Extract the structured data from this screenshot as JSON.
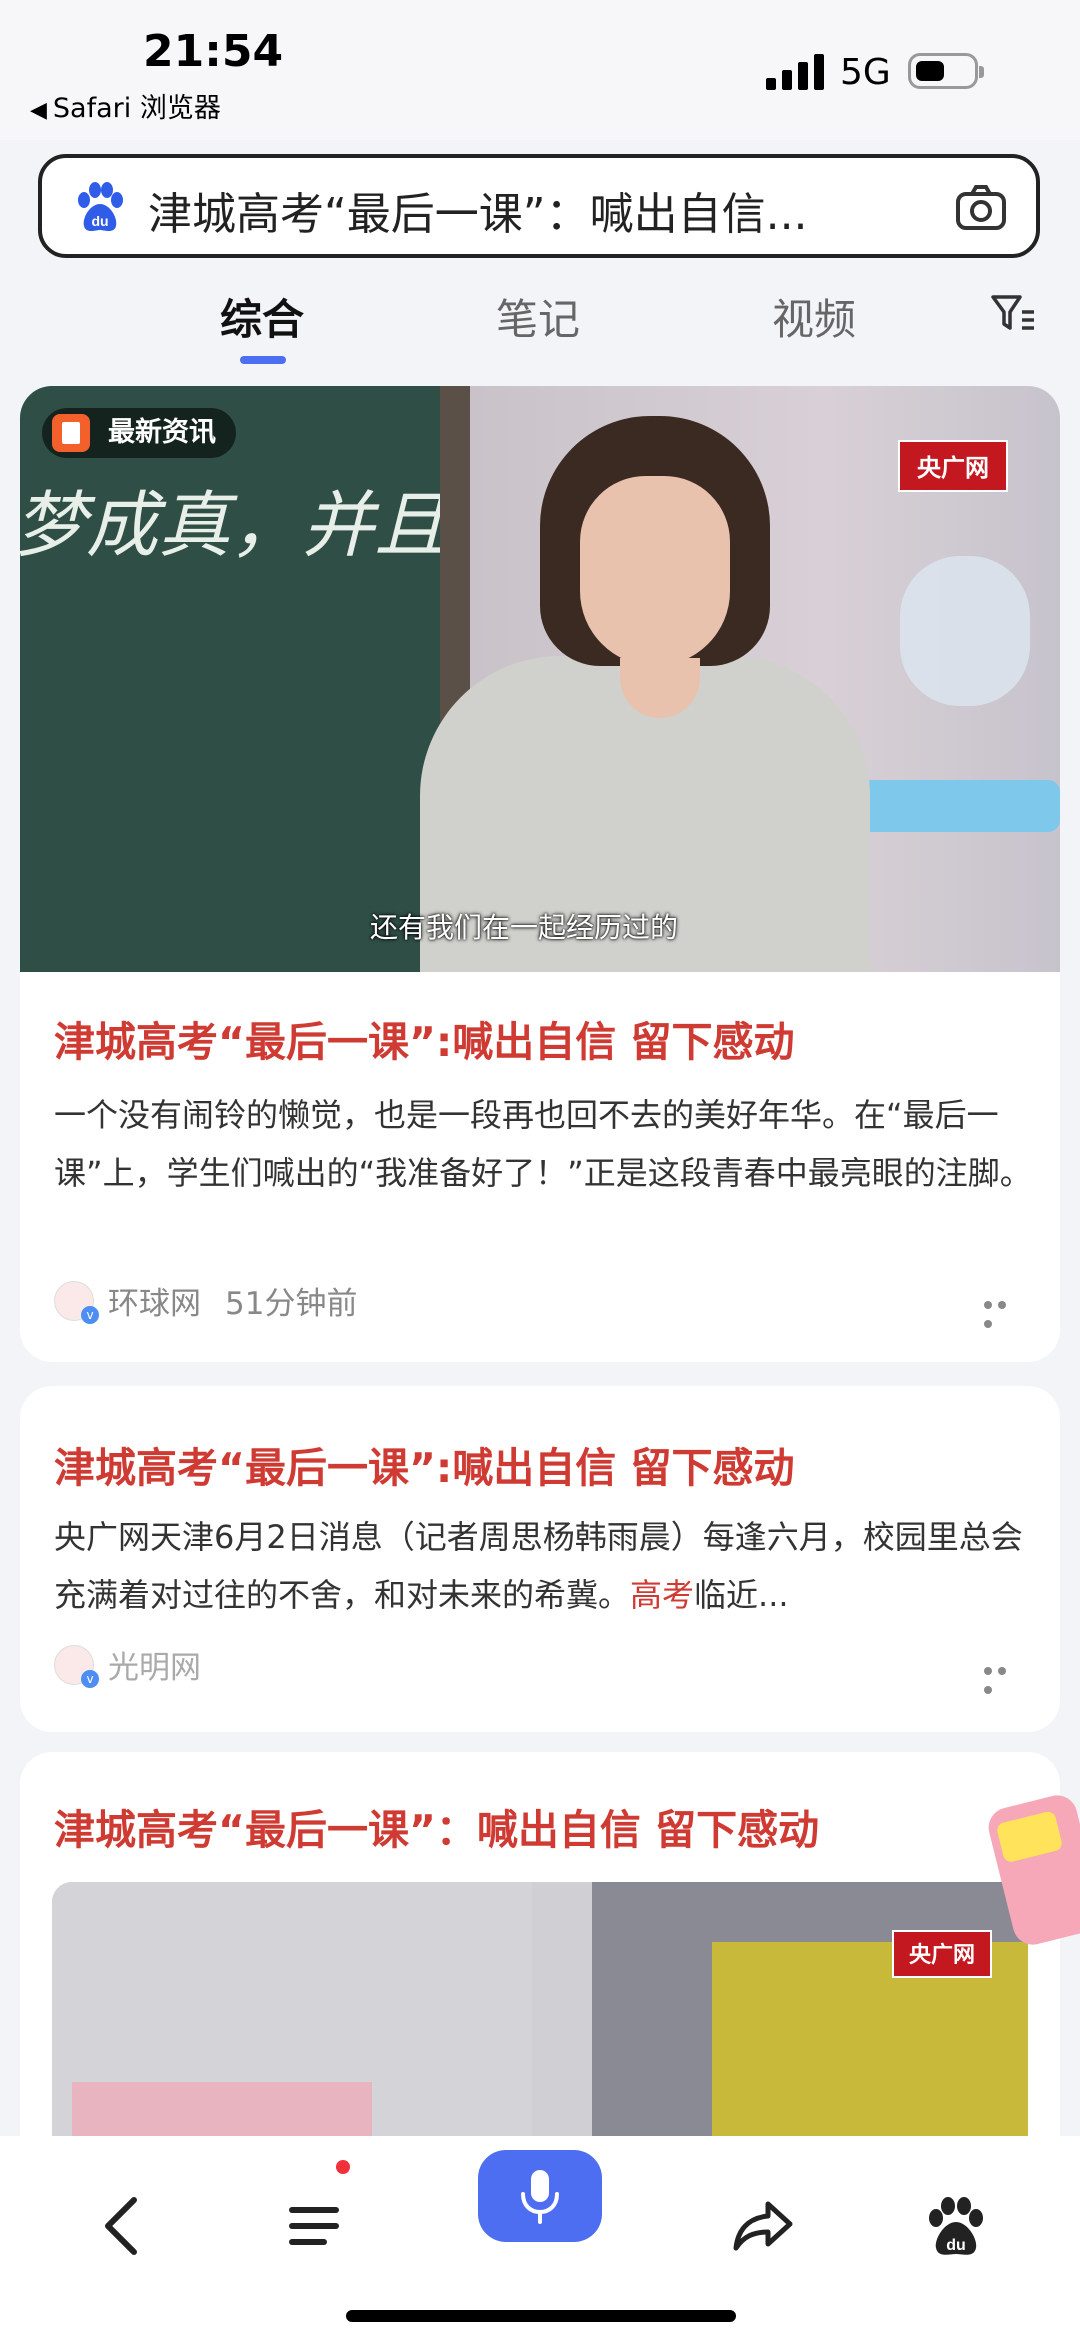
{
  "status_bar": {
    "time": "21:54",
    "back_app": "Safari 浏览器",
    "network": "5G"
  },
  "search": {
    "query": "津城高考“最后一课”：喊出自信..."
  },
  "tabs": [
    {
      "label": "综合",
      "active": true
    },
    {
      "label": "笔记",
      "active": false
    },
    {
      "label": "视频",
      "active": false
    }
  ],
  "cards": [
    {
      "badge": "最新资讯",
      "image_logo": "央广网",
      "image_subtitle": "还有我们在一起经历过的",
      "image_chalk_text": "梦成真，并且",
      "title": "津城高考“最后一课”:喊出自信 留下感动",
      "summary": "一个没有闹铃的懒觉，也是一段再也回不去的美好年华。在“最后一课”上，学生们喊出的“我准备好了！”正是这段青春中最亮眼的注脚。",
      "source": "环球网",
      "time": "51分钟前"
    },
    {
      "title": "津城高考“最后一课”:喊出自信 留下感动",
      "summary_before": "央广网天津6月2日消息（记者周思杨韩雨晨）每逢六月，校园里总会充满着对过往的不舍，和对未来的希冀。",
      "summary_highlight": "高考",
      "summary_after": "临近...",
      "source": "光明网"
    },
    {
      "title": "津城高考“最后一课”：喊出自信 留下感动",
      "image_logo": "央广网"
    }
  ],
  "colors": {
    "accent": "#4e6ef2",
    "headline": "#cf3b33",
    "badge_orange": "#f3602b"
  },
  "icons": [
    "baidu-paw-icon",
    "camera-icon",
    "filter-icon",
    "more-icon",
    "back-icon",
    "menu-icon",
    "mic-icon",
    "share-icon",
    "baidu-home-icon"
  ]
}
